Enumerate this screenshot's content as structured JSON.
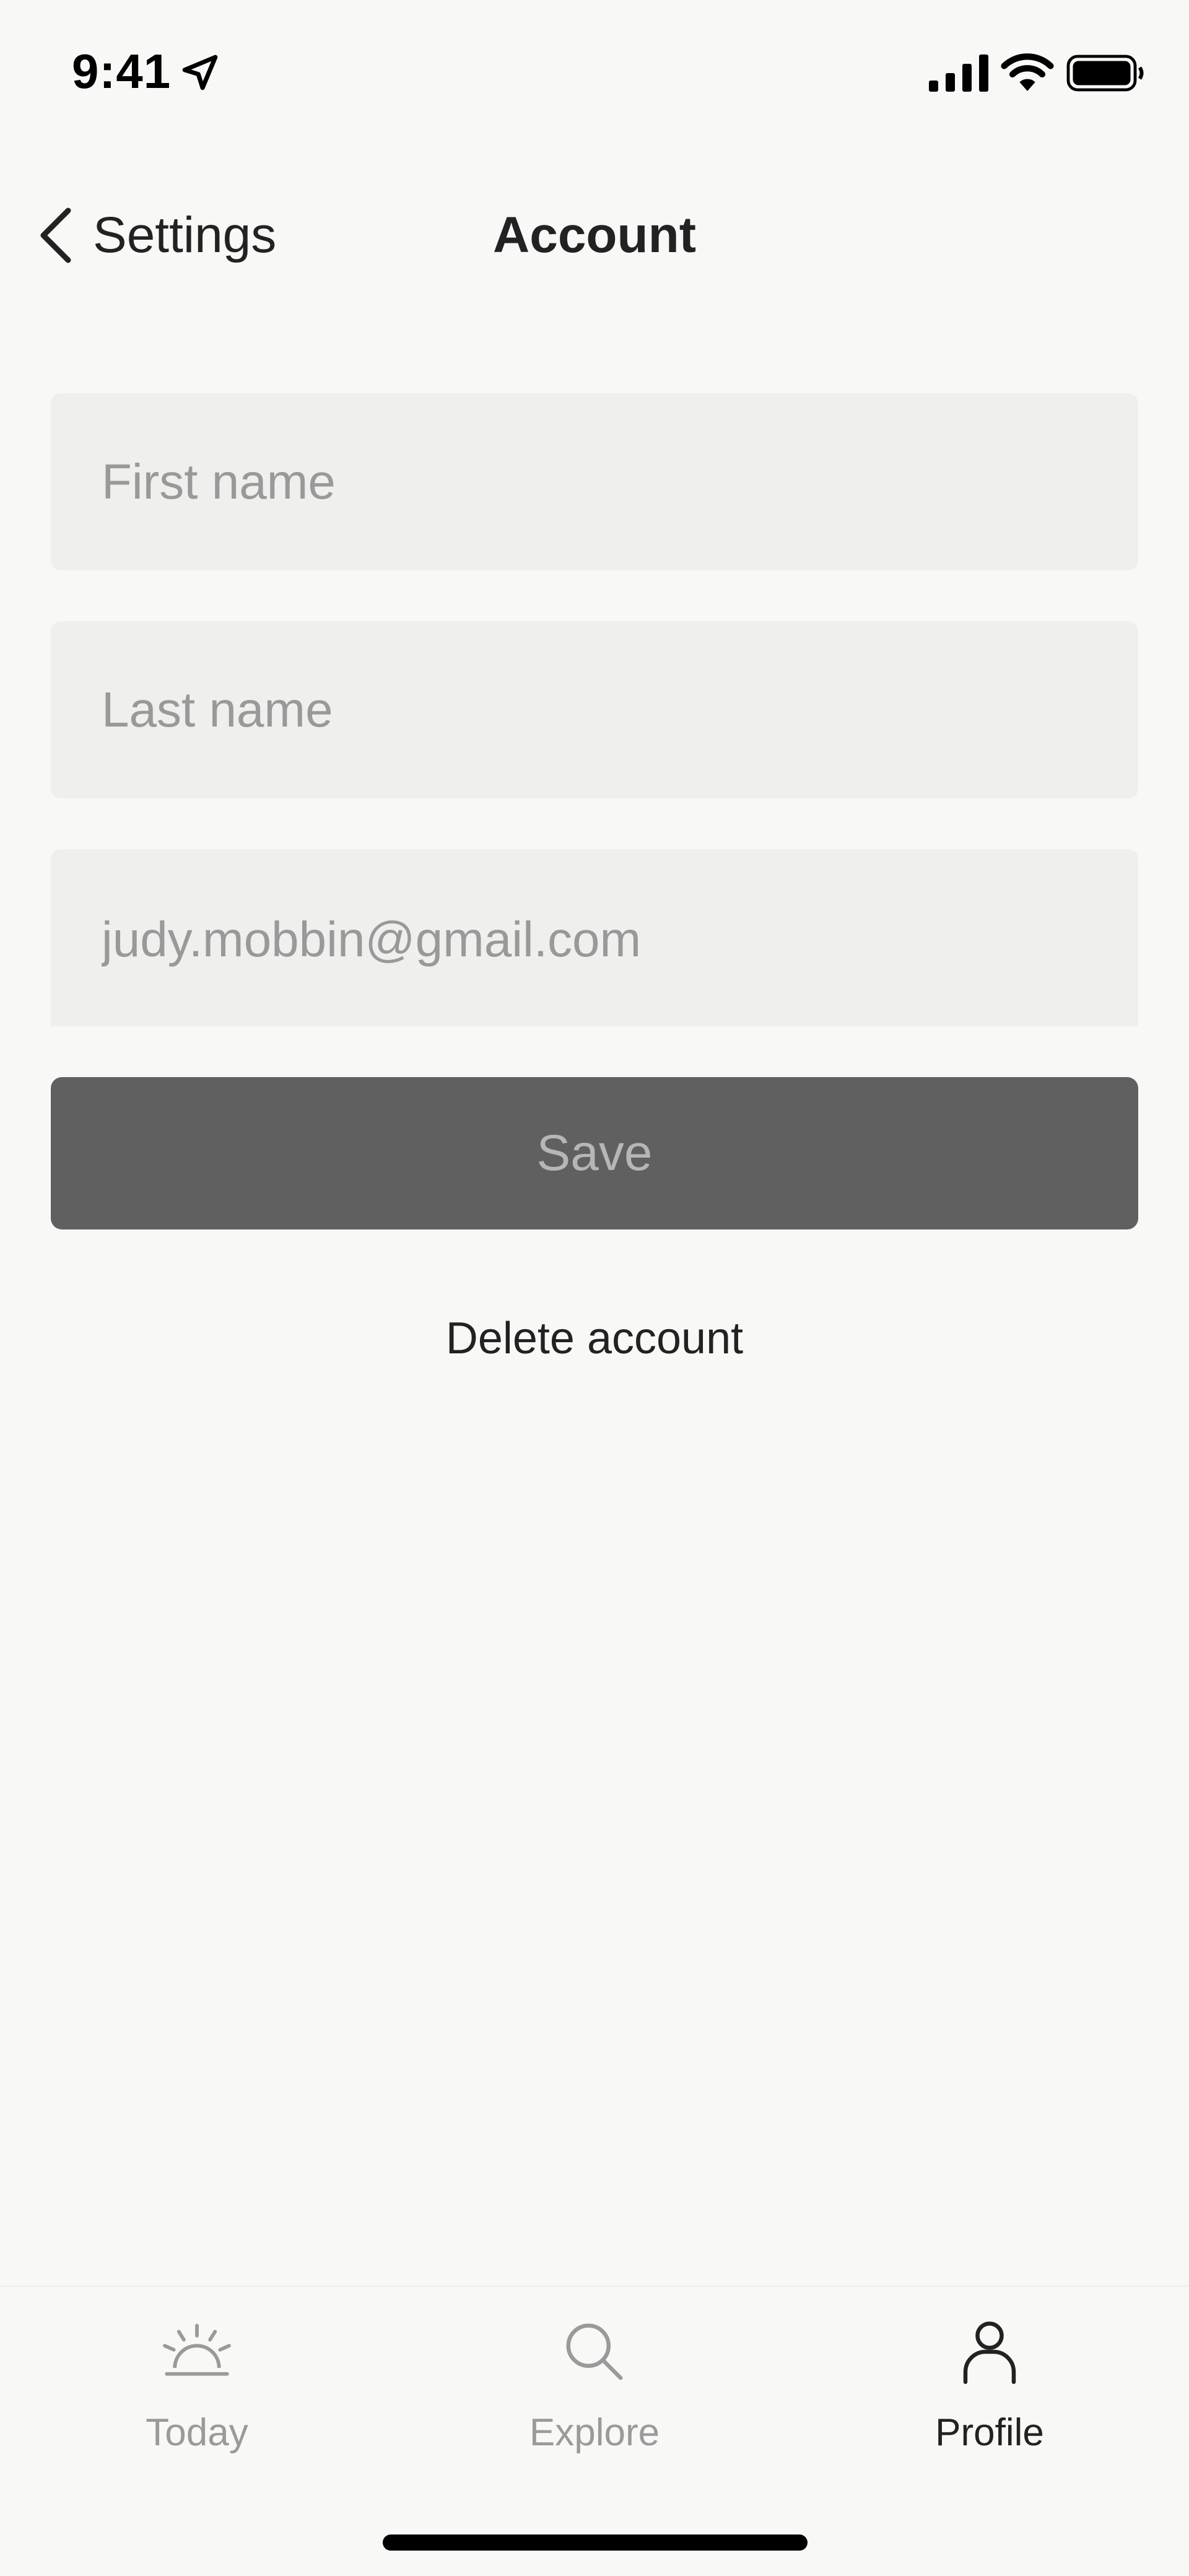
{
  "status_bar": {
    "time": "9:41",
    "icons": [
      "location-arrow-icon",
      "cellular-signal-icon",
      "wifi-icon",
      "battery-icon"
    ]
  },
  "nav": {
    "back_label": "Settings",
    "title": "Account"
  },
  "form": {
    "first_name": {
      "value": "",
      "placeholder": "First name"
    },
    "last_name": {
      "value": "",
      "placeholder": "Last name"
    },
    "email": {
      "value": "judy.mobbin@gmail.com",
      "placeholder": ""
    },
    "save_label": "Save"
  },
  "delete_label": "Delete account",
  "tabs": [
    {
      "label": "Today",
      "icon": "sunrise-icon",
      "active": false
    },
    {
      "label": "Explore",
      "icon": "search-icon",
      "active": false
    },
    {
      "label": "Profile",
      "icon": "person-icon",
      "active": true
    }
  ],
  "colors": {
    "background": "#f8f8f6",
    "field_background": "#efefed",
    "save_background": "#606060",
    "placeholder_text": "#999999",
    "primary_text": "#222222"
  }
}
